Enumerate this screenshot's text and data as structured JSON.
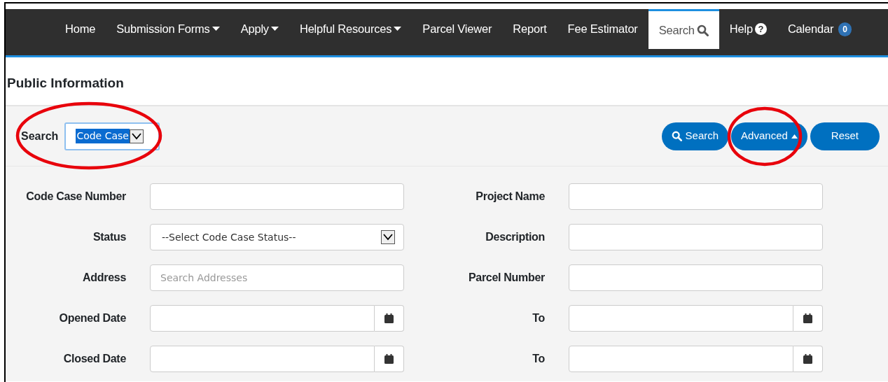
{
  "nav": [
    {
      "label": "Home",
      "kind": "link",
      "selected": false
    },
    {
      "label": "Submission Forms",
      "kind": "dropdown",
      "selected": false
    },
    {
      "label": "Apply",
      "kind": "dropdown",
      "selected": false
    },
    {
      "label": "Helpful Resources",
      "kind": "dropdown",
      "selected": false
    },
    {
      "label": "Parcel Viewer",
      "kind": "link",
      "selected": false
    },
    {
      "label": "Report",
      "kind": "link",
      "selected": false
    },
    {
      "label": "Fee Estimator",
      "kind": "link",
      "selected": false
    },
    {
      "label": "Search",
      "kind": "search",
      "selected": true
    },
    {
      "label": "Help",
      "kind": "help",
      "symbol": "?",
      "selected": false
    },
    {
      "label": "Calendar",
      "kind": "badge",
      "badge": "0",
      "selected": false
    }
  ],
  "page_title": "Public Information",
  "search_type": {
    "label": "Search",
    "value": "Code Case",
    "circled": true
  },
  "buttons": [
    {
      "kind": "search",
      "label": "Search",
      "circled": false
    },
    {
      "kind": "toggle",
      "label": "Advanced",
      "circled": true
    },
    {
      "kind": "plain",
      "label": "Reset",
      "circled": false
    }
  ],
  "fields": [
    {
      "label": "Code Case Number",
      "kind": "text"
    },
    {
      "label": "Project Name",
      "kind": "text"
    },
    {
      "label": "Status",
      "kind": "select",
      "value": "--Select Code Case Status--"
    },
    {
      "label": "Description",
      "kind": "text"
    },
    {
      "label": "Address",
      "kind": "text",
      "placeholder": "Search Addresses"
    },
    {
      "label": "Parcel Number",
      "kind": "text"
    },
    {
      "label": "Opened Date",
      "kind": "date"
    },
    {
      "label": "To",
      "kind": "date"
    },
    {
      "label": "Closed Date",
      "kind": "date"
    },
    {
      "label": "To",
      "kind": "date"
    }
  ]
}
